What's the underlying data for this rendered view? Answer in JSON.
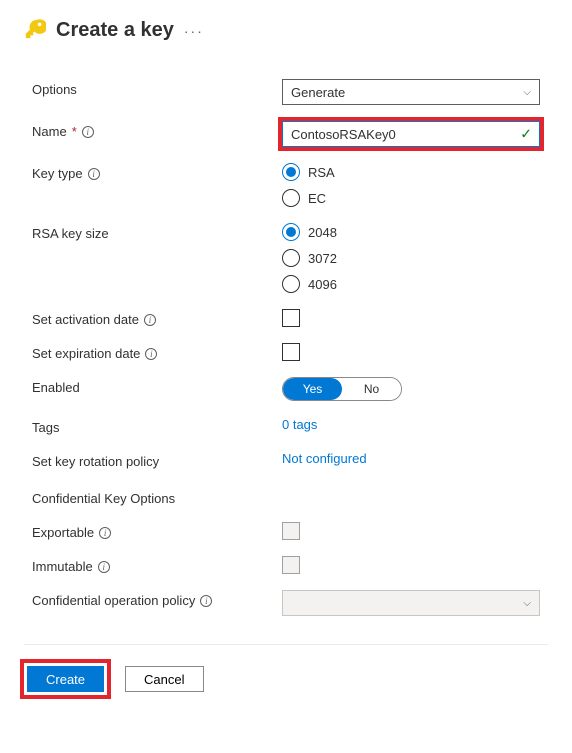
{
  "header": {
    "title": "Create a key"
  },
  "form": {
    "options": {
      "label": "Options",
      "value": "Generate"
    },
    "name": {
      "label": "Name",
      "value": "ContosoRSAKey0"
    },
    "keyType": {
      "label": "Key type",
      "options": [
        "RSA",
        "EC"
      ],
      "selected": "RSA"
    },
    "rsaKeySize": {
      "label": "RSA key size",
      "options": [
        "2048",
        "3072",
        "4096"
      ],
      "selected": "2048"
    },
    "activationDate": {
      "label": "Set activation date"
    },
    "expirationDate": {
      "label": "Set expiration date"
    },
    "enabled": {
      "label": "Enabled",
      "options": [
        "Yes",
        "No"
      ],
      "selected": "Yes"
    },
    "tags": {
      "label": "Tags",
      "link": "0 tags"
    },
    "rotationPolicy": {
      "label": "Set key rotation policy",
      "link": "Not configured"
    },
    "confidential": {
      "heading": "Confidential Key Options",
      "exportable": {
        "label": "Exportable"
      },
      "immutable": {
        "label": "Immutable"
      },
      "operationPolicy": {
        "label": "Confidential operation policy"
      }
    }
  },
  "footer": {
    "create": "Create",
    "cancel": "Cancel"
  }
}
